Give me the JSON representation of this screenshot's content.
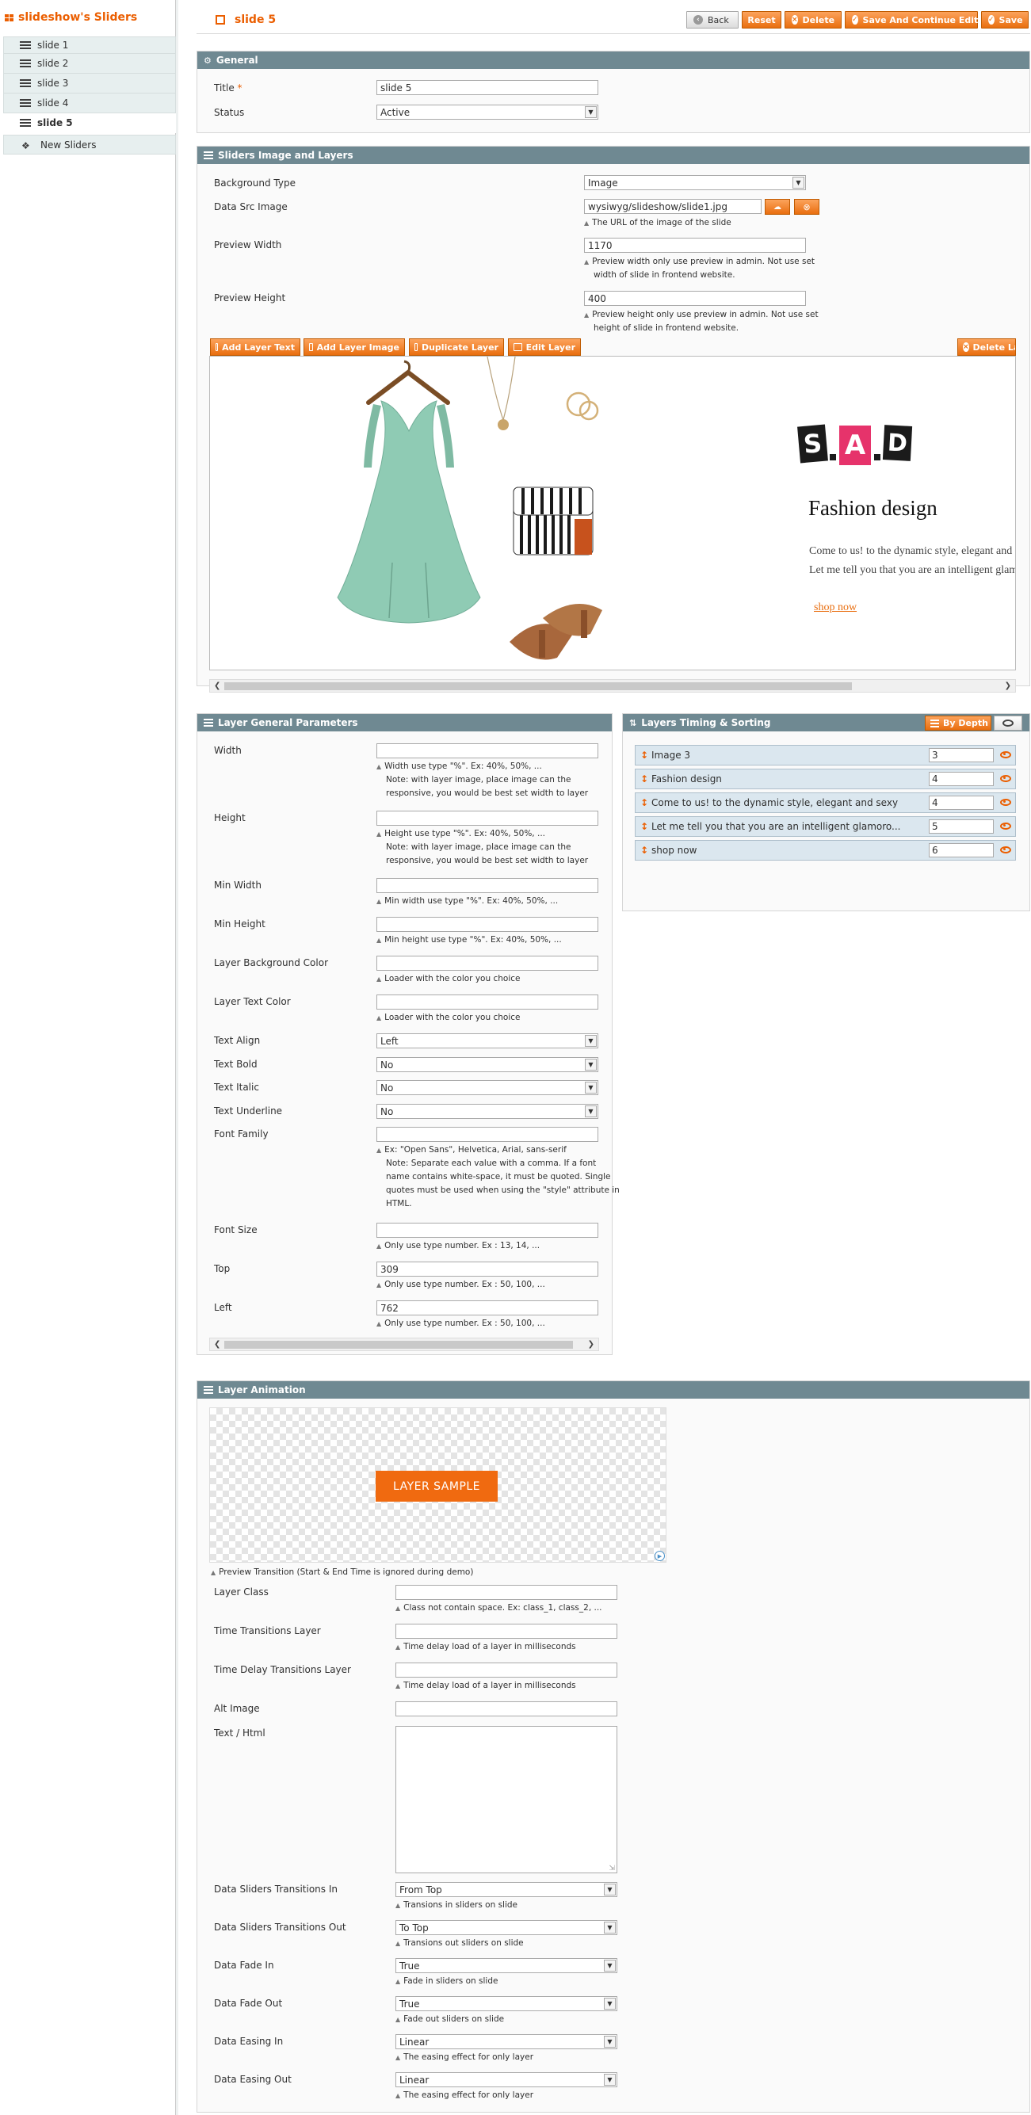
{
  "sidebar": {
    "title": "slideshow's Sliders",
    "items": [
      "slide 1",
      "slide 2",
      "slide 3",
      "slide 4",
      "slide 5"
    ],
    "new_label": "New Sliders"
  },
  "header": {
    "title": "slide 5",
    "back": "Back",
    "reset": "Reset",
    "delete": "Delete",
    "save_continue": "Save And Continue Edit",
    "save": "Save"
  },
  "general": {
    "heading": "General",
    "title_label": "Title",
    "title_value": "slide 5",
    "status_label": "Status",
    "status_value": "Active"
  },
  "images": {
    "heading": "Sliders Image and Layers",
    "bg_type_label": "Background Type",
    "bg_type_value": "Image",
    "src_label": "Data Src Image",
    "src_value": "wysiwyg/slideshow/slide1.jpg",
    "src_note": "The URL of the image of the slide",
    "pw_label": "Preview Width",
    "pw_value": "1170",
    "pw_note1": "Preview width only use preview in admin. Not use set",
    "pw_note2": "width of slide in frontend website.",
    "ph_label": "Preview Height",
    "ph_value": "400",
    "ph_note1": "Preview height only use preview in admin. Not use set",
    "ph_note2": "height of slide in frontend website.",
    "toolbar": {
      "add_text": "Add Layer Text",
      "add_image": "Add Layer Image",
      "duplicate": "Duplicate Layer",
      "edit": "Edit Layer",
      "delete": "Delete La"
    },
    "preview": {
      "brand": [
        "S",
        "A",
        "D"
      ],
      "headline": "Fashion design",
      "line1": "Come to us! to the dynamic style, elegant and",
      "line2": "Let me tell you that you are an intelligent glam",
      "link": "shop now"
    }
  },
  "params": {
    "heading": "Layer General Parameters",
    "width_label": "Width",
    "width_note1": "Width use type \"%\". Ex: 40%, 50%, ...",
    "width_note2": "Note: with layer image, place image can the",
    "width_note3": "responsive, you would be best set width to layer",
    "height_label": "Height",
    "height_note1": "Height use type \"%\". Ex: 40%, 50%, ...",
    "height_note2": "Note: with layer image, place image can the",
    "height_note3": "responsive, you would be best set width to layer",
    "minw_label": "Min Width",
    "minw_note": "Min width use type \"%\". Ex: 40%, 50%, ...",
    "minh_label": "Min Height",
    "minh_note": "Min height use type \"%\". Ex: 40%, 50%, ...",
    "bg_label": "Layer Background Color",
    "bg_note": "Loader with the color you choice",
    "tc_label": "Layer Text Color",
    "tc_note": "Loader with the color you choice",
    "align_label": "Text Align",
    "align_value": "Left",
    "bold_label": "Text Bold",
    "bold_value": "No",
    "italic_label": "Text Italic",
    "italic_value": "No",
    "underline_label": "Text Underline",
    "underline_value": "No",
    "ff_label": "Font Family",
    "ff_note1": "Ex: \"Open Sans\", Helvetica, Arial, sans-serif",
    "ff_note2": "Note: Separate each value with a comma. If a font",
    "ff_note3": "name contains white-space, it must be quoted. Single",
    "ff_note4": "quotes must be used when using the \"style\" attribute in",
    "ff_note5": "HTML.",
    "fs_label": "Font Size",
    "fs_note": "Only use type number. Ex : 13, 14, ...",
    "top_label": "Top",
    "top_value": "309",
    "top_note": "Only use type number. Ex : 50, 100, ...",
    "left_label": "Left",
    "left_value": "762",
    "left_note": "Only use type number. Ex : 50, 100, ..."
  },
  "timing": {
    "heading": "Layers Timing & Sorting",
    "by_depth": "By Depth",
    "layers": [
      {
        "name": "Image 3",
        "depth": "3"
      },
      {
        "name": "Fashion design",
        "depth": "4"
      },
      {
        "name": "Come to us! to the dynamic style, elegant and sexy",
        "depth": "4"
      },
      {
        "name": "Let me tell you that you are an intelligent glamoro...",
        "depth": "5"
      },
      {
        "name": "shop now",
        "depth": "6"
      }
    ]
  },
  "animation": {
    "heading": "Layer Animation",
    "sample": "LAYER SAMPLE",
    "preview_note": "Preview Transition (Start & End Time is ignored during demo)",
    "class_label": "Layer Class",
    "class_note": "Class not contain space. Ex: class_1, class_2, ...",
    "ttl_label": "Time Transitions Layer",
    "ttl_note": "Time delay load of a layer in milliseconds",
    "tdtl_label": "Time Delay Transitions Layer",
    "tdtl_note": "Time delay load of a layer in milliseconds",
    "alt_label": "Alt Image",
    "text_label": "Text / Html",
    "tin_label": "Data Sliders Transitions In",
    "tin_value": "From Top",
    "tin_note": "Transions in sliders on slide",
    "tout_label": "Data Sliders Transitions Out",
    "tout_value": "To Top",
    "tout_note": "Transions out sliders on slide",
    "fin_label": "Data Fade In",
    "fin_value": "True",
    "fin_note": "Fade in sliders on slide",
    "fout_label": "Data Fade Out",
    "fout_value": "True",
    "fout_note": "Fade out sliders on slide",
    "ein_label": "Data Easing In",
    "ein_value": "Linear",
    "ein_note": "The easing effect for only layer",
    "eout_label": "Data Easing Out",
    "eout_value": "Linear",
    "eout_note": "The easing effect for only layer"
  }
}
